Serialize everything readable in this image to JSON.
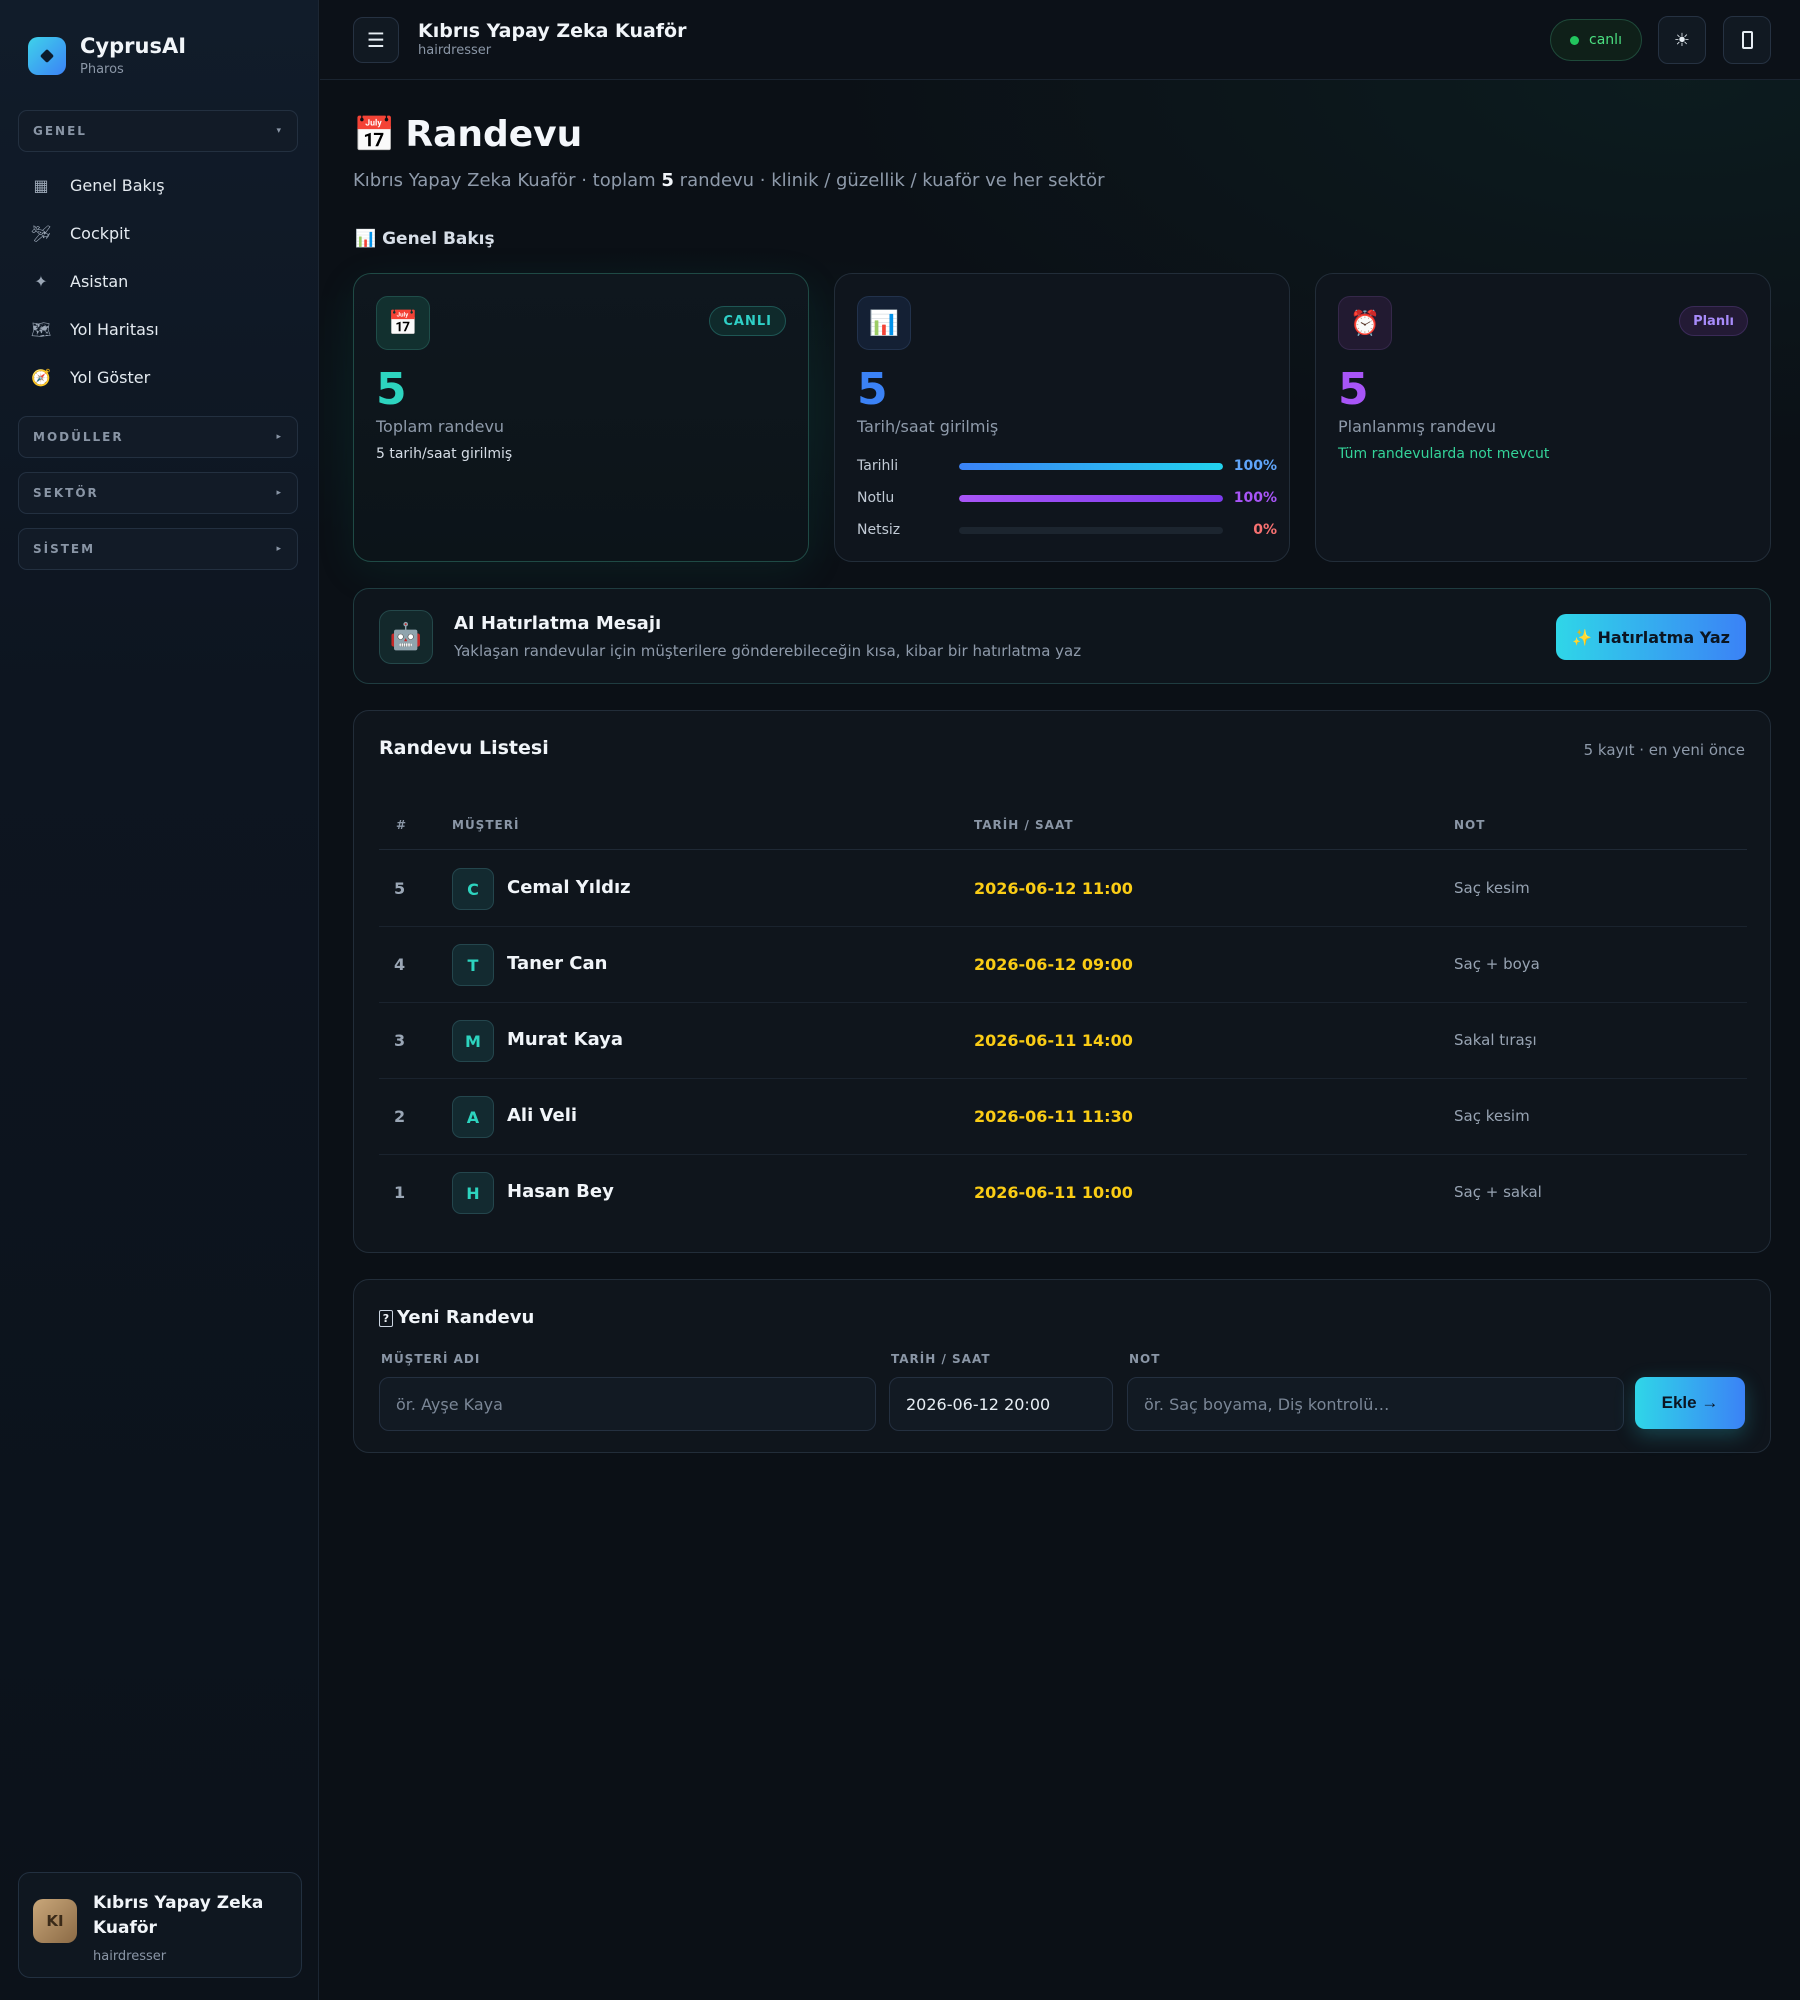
{
  "brand": {
    "name": "CyprusAI",
    "sub": "Pharos"
  },
  "sidebar": {
    "groups": [
      {
        "label": "GENEL",
        "caret": "▾"
      },
      {
        "label": "MODÜLLER",
        "caret": "▸"
      },
      {
        "label": "SEKTÖR",
        "caret": "▸"
      },
      {
        "label": "SİSTEM",
        "caret": "▸"
      }
    ],
    "items": [
      {
        "icon": "▦",
        "label": "Genel Bakış"
      },
      {
        "icon": "🛩",
        "label": "Cockpit"
      },
      {
        "icon": "✦",
        "label": "Asistan"
      },
      {
        "icon": "🗺",
        "label": "Yol Haritası"
      },
      {
        "icon": "🧭",
        "label": "Yol Göster"
      }
    ],
    "profile": {
      "initials": "KI",
      "name": "Kıbrıs Yapay Zeka Kuaför",
      "role": "hairdresser"
    }
  },
  "topbar": {
    "menu_icon": "☰",
    "title": "Kıbrıs Yapay Zeka Kuaför",
    "sub": "hairdresser",
    "live_label": "canlı",
    "theme_icon": "☀"
  },
  "page": {
    "emoji": "📅",
    "title": "Randevu",
    "sub_prefix": "Kıbrıs Yapay Zeka Kuaför · toplam ",
    "sub_count": "5",
    "sub_suffix": " randevu · klinik / güzellik / kuaför ve her sektör",
    "section_label": "📊 Genel Bakış"
  },
  "cards": {
    "total": {
      "icon": "📅",
      "badge": "CANLI",
      "value": "5",
      "label": "Toplam randevu",
      "note": "5 tarih/saat girilmiş"
    },
    "dated": {
      "icon": "📊",
      "value": "5",
      "label": "Tarih/saat girilmiş",
      "bars": [
        {
          "label": "Tarihli",
          "pct": "100%",
          "fraction": 1.0,
          "color": "#60a5fa"
        },
        {
          "label": "Notlu",
          "pct": "100%",
          "fraction": 1.0,
          "color": "#a855f7"
        },
        {
          "label": "Netsiz",
          "pct": "0%",
          "fraction": 0.0,
          "color": "#f87171"
        }
      ]
    },
    "planned": {
      "icon": "⏰",
      "badge": "Planlı",
      "value": "5",
      "label": "Planlanmış randevu",
      "note": "Tüm randevularda not mevcut"
    }
  },
  "ai": {
    "icon": "🤖",
    "title": "AI Hatırlatma Mesajı",
    "desc": "Yaklaşan randevular için müşterilere gönderebileceğin kısa, kibar bir hatırlatma yaz",
    "button": "✨ Hatırlatma Yaz"
  },
  "list": {
    "title": "Randevu Listesi",
    "meta": "5 kayıt · en yeni önce",
    "headers": {
      "num": "#",
      "customer": "MÜŞTERİ",
      "datetime": "TARİH / SAAT",
      "note": "NOT"
    },
    "rows": [
      {
        "num": "5",
        "initial": "C",
        "name": "Cemal Yıldız",
        "datetime": "2026-06-12 11:00",
        "note": "Saç kesim"
      },
      {
        "num": "4",
        "initial": "T",
        "name": "Taner Can",
        "datetime": "2026-06-12 09:00",
        "note": "Saç + boya"
      },
      {
        "num": "3",
        "initial": "M",
        "name": "Murat Kaya",
        "datetime": "2026-06-11 14:00",
        "note": "Sakal tıraşı"
      },
      {
        "num": "2",
        "initial": "A",
        "name": "Ali Veli",
        "datetime": "2026-06-11 11:30",
        "note": "Saç kesim"
      },
      {
        "num": "1",
        "initial": "H",
        "name": "Hasan Bey",
        "datetime": "2026-06-11 10:00",
        "note": "Saç + sakal"
      }
    ]
  },
  "form": {
    "title": "Yeni Randevu",
    "q_icon": "?",
    "name_label": "MÜŞTERİ ADI",
    "name_placeholder": "ör. Ayşe Kaya",
    "datetime_label": "TARİH / SAAT",
    "datetime_value": "2026-06-12 20:00",
    "note_label": "NOT",
    "note_placeholder": "ör. Saç boyama, Diş kontrolü…",
    "add_button": "Ekle →"
  }
}
